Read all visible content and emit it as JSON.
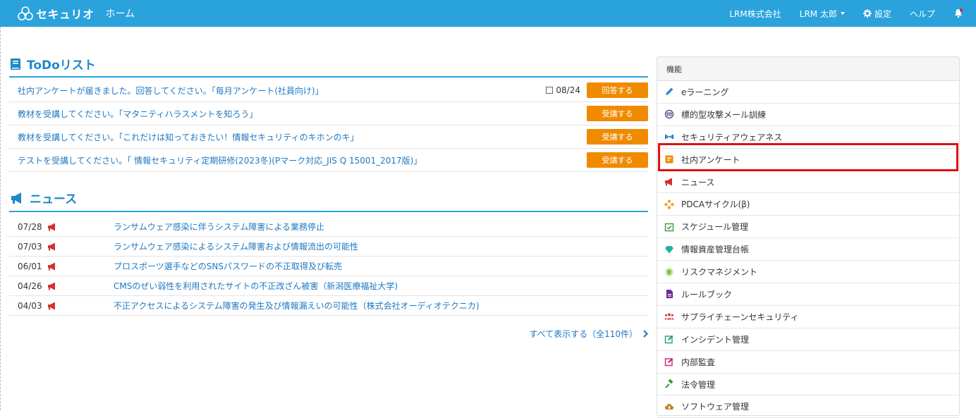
{
  "header": {
    "brand": "セキュリオ",
    "home": "ホーム",
    "company": "LRM株式会社",
    "user": "LRM 太郎",
    "settings": "設定",
    "help": "ヘルプ"
  },
  "todo": {
    "title": "ToDoリスト",
    "items": [
      {
        "text": "社内アンケートが届きました。回答してください。「毎月アンケート(社員向け)」",
        "date": "08/24",
        "action": "回答する"
      },
      {
        "text": "教材を受講してください。「マタニティハラスメントを知ろう」",
        "date": "",
        "action": "受講する"
      },
      {
        "text": "教材を受講してください。「これだけは知っておきたい！情報セキュリティのキホンのキ」",
        "date": "",
        "action": "受講する"
      },
      {
        "text": "テストを受講してください。「 情報セキュリティ定期研修(2023冬)(Pマーク対応_JIS Q 15001_2017版)」",
        "date": "",
        "action": "受講する"
      }
    ]
  },
  "news": {
    "title": "ニュース",
    "items": [
      {
        "date": "07/28",
        "title": "ランサムウェア感染に伴うシステム障害による業務停止"
      },
      {
        "date": "07/03",
        "title": "ランサムウェア感染によるシステム障害および情報流出の可能性"
      },
      {
        "date": "06/01",
        "title": "プロスポーツ選手などのSNSパスワードの不正取得及び転売"
      },
      {
        "date": "04/26",
        "title": "CMSのぜい弱性を利用されたサイトの不正改ざん被害（新潟医療福祉大学)"
      },
      {
        "date": "04/03",
        "title": "不正アクセスによるシステム障害の発生及び情報漏えいの可能性（株式会社オーディオテクニカ)"
      }
    ],
    "show_all": "すべて表示する（全110件）"
  },
  "panel": {
    "title": "機能",
    "items": [
      {
        "label": "eラーニング",
        "icon": "pencil-icon",
        "color": "#2a8bd8"
      },
      {
        "label": "標的型攻撃メール訓練",
        "icon": "target-mail-icon",
        "color": "#5a4a8a"
      },
      {
        "label": "セキュリティアウェアネス",
        "icon": "dumbbell-icon",
        "color": "#1e6fc8"
      },
      {
        "label": "社内アンケート",
        "icon": "survey-icon",
        "color": "#f08a00"
      },
      {
        "label": "ニュース",
        "icon": "megaphone-icon",
        "color": "#d43030"
      },
      {
        "label": "PDCAサイクル(β)",
        "icon": "cycle-icon",
        "color": "#f0a020"
      },
      {
        "label": "スケジュール管理",
        "icon": "calendar-check-icon",
        "color": "#3a9a3a"
      },
      {
        "label": "情報資産管理台帳",
        "icon": "diamond-icon",
        "color": "#20b0a0"
      },
      {
        "label": "リスクマネジメント",
        "icon": "shield-icon",
        "color": "#8ac040"
      },
      {
        "label": "ルールブック",
        "icon": "document-icon",
        "color": "#6a2a9a"
      },
      {
        "label": "サプライチェーンセキュリティ",
        "icon": "group-icon",
        "color": "#e04040"
      },
      {
        "label": "インシデント管理",
        "icon": "edit-icon",
        "color": "#20a070"
      },
      {
        "label": "内部監査",
        "icon": "audit-edit-icon",
        "color": "#d02080"
      },
      {
        "label": "法令管理",
        "icon": "gavel-icon",
        "color": "#3a9a3a"
      },
      {
        "label": "ソフトウェア管理",
        "icon": "cloud-download-icon",
        "color": "#c08020"
      }
    ]
  },
  "colors": {
    "header_bg": "#2aa2dc",
    "accent_blue": "#1e88c9",
    "button_orange": "#f08a00",
    "highlight_red": "#e01010"
  }
}
